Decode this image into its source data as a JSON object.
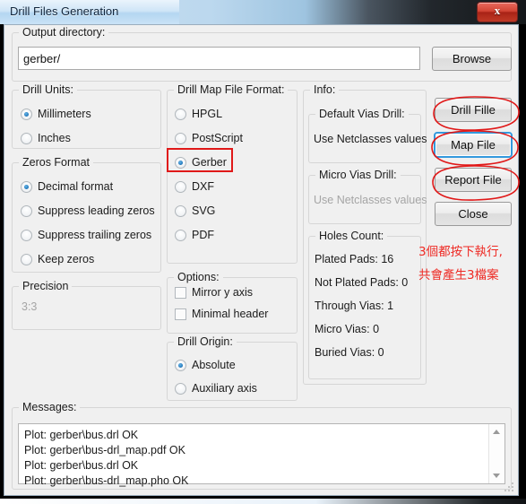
{
  "window": {
    "title": "Drill Files Generation",
    "close_icon": "close-x-icon",
    "close_label": "x"
  },
  "output_directory": {
    "caption": "Output directory:",
    "value": "gerber/",
    "placeholder": "",
    "browse_label": "Browse"
  },
  "drill_units": {
    "caption": "Drill Units:",
    "options": [
      {
        "label": "Millimeters",
        "selected": true
      },
      {
        "label": "Inches",
        "selected": false
      }
    ]
  },
  "zeros_format": {
    "caption": "Zeros Format",
    "options": [
      {
        "label": "Decimal format",
        "selected": true
      },
      {
        "label": "Suppress leading zeros",
        "selected": false
      },
      {
        "label": "Suppress trailing zeros",
        "selected": false
      },
      {
        "label": "Keep zeros",
        "selected": false
      }
    ]
  },
  "precision": {
    "caption": "Precision",
    "value": "3:3",
    "disabled": true
  },
  "drill_map_format": {
    "caption": "Drill Map File Format:",
    "options": [
      {
        "label": "HPGL",
        "selected": false
      },
      {
        "label": "PostScript",
        "selected": false
      },
      {
        "label": "Gerber",
        "selected": true
      },
      {
        "label": "DXF",
        "selected": false
      },
      {
        "label": "SVG",
        "selected": false
      },
      {
        "label": "PDF",
        "selected": false
      }
    ]
  },
  "options": {
    "caption": "Options:",
    "items": [
      {
        "label": "Mirror y axis",
        "checked": false
      },
      {
        "label": "Minimal header",
        "checked": false
      }
    ]
  },
  "drill_origin": {
    "caption": "Drill Origin:",
    "options": [
      {
        "label": "Absolute",
        "selected": true
      },
      {
        "label": "Auxiliary axis",
        "selected": false
      }
    ]
  },
  "info": {
    "caption": "Info:",
    "default_vias_drill": {
      "caption": "Default Vias Drill:",
      "value": "Use Netclasses values"
    },
    "micro_vias_drill": {
      "caption": "Micro Vias Drill:",
      "value": "Use Netclasses values",
      "disabled": true
    },
    "holes_count": {
      "caption": "Holes Count:",
      "rows": [
        "Plated Pads: 16",
        "Not Plated Pads: 0",
        "Through Vias: 1",
        "Micro Vias: 0",
        "Buried Vias: 0"
      ]
    }
  },
  "buttons": {
    "drill_file": "Drill Fille",
    "map_file": "Map File",
    "report_file": "Report File",
    "close": "Close"
  },
  "annotation": {
    "line1": "3個都按下執行,",
    "line2": "共會產生3檔案",
    "color": "#ee2a24"
  },
  "messages": {
    "caption": "Messages:",
    "lines": [
      "Plot: gerber\\bus.drl OK",
      "Plot: gerber\\bus-drl_map.pdf OK",
      "Plot: gerber\\bus.drl OK",
      "Plot: gerber\\bus-drl_map.pho OK"
    ],
    "scroll_up_icon": "triangle-up-icon",
    "scroll_down_icon": "triangle-down-icon"
  }
}
